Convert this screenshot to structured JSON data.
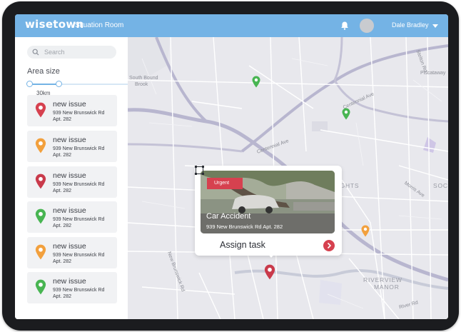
{
  "header": {
    "logo": "wisetown",
    "title": "Situation Room",
    "user_name": "Dale Bradley",
    "icons": {
      "notifications": "bell-icon",
      "account_menu": "chevron-down-icon"
    }
  },
  "sidebar": {
    "search_placeholder": "Search",
    "area_size_label": "Area size",
    "area_size_value": "30km",
    "issues": [
      {
        "title": "new issue",
        "address_line1": "939 New Brunswick Rd",
        "address_line2": "Apt. 282",
        "status_color": "#d6414f"
      },
      {
        "title": "new issue",
        "address_line1": "939 New Brunswick Rd",
        "address_line2": "Apt. 282",
        "status_color": "#f2a03d"
      },
      {
        "title": "new issue",
        "address_line1": "939 New Brunswick Rd",
        "address_line2": "Apt. 282",
        "status_color": "#c93a4b"
      },
      {
        "title": "new issue",
        "address_line1": "939 New Brunswick Rd",
        "address_line2": "Apt. 282",
        "status_color": "#48b552"
      },
      {
        "title": "new issue",
        "address_line1": "939 New Brunswick Rd",
        "address_line2": "Apt. 282",
        "status_color": "#f2a03d"
      },
      {
        "title": "new issue",
        "address_line1": "939 New Brunswick Rd",
        "address_line2": "Apt. 282",
        "status_color": "#48b552"
      }
    ]
  },
  "map": {
    "labels": {
      "south_bound_brook": "South Bound",
      "brook": "Brook",
      "piscataway": "Piscataway",
      "heights": "HEIGHTS",
      "soci": "SOCI",
      "riverview_manor_1": "RIVERVIEW",
      "riverview_manor_2": "MANOR",
      "centennial_ave": "Centennial Ave",
      "stelton_rd": "Stelton Rd",
      "river_rd": "River Rd",
      "morris_ave": "Morris Ave",
      "new_brunswick_rd": "New Brunswick Rd",
      "centennial_ave2": "Centennial Ave"
    },
    "popup": {
      "badge": "Urgent",
      "title": "Car Accident",
      "address": "939 New Brunswick Rd Apt. 282",
      "action_label": "Assign task"
    },
    "colors": {
      "urgent": "#d6414f",
      "warning": "#f2a03d",
      "ok": "#48b552",
      "accent": "#74b3e5"
    }
  }
}
